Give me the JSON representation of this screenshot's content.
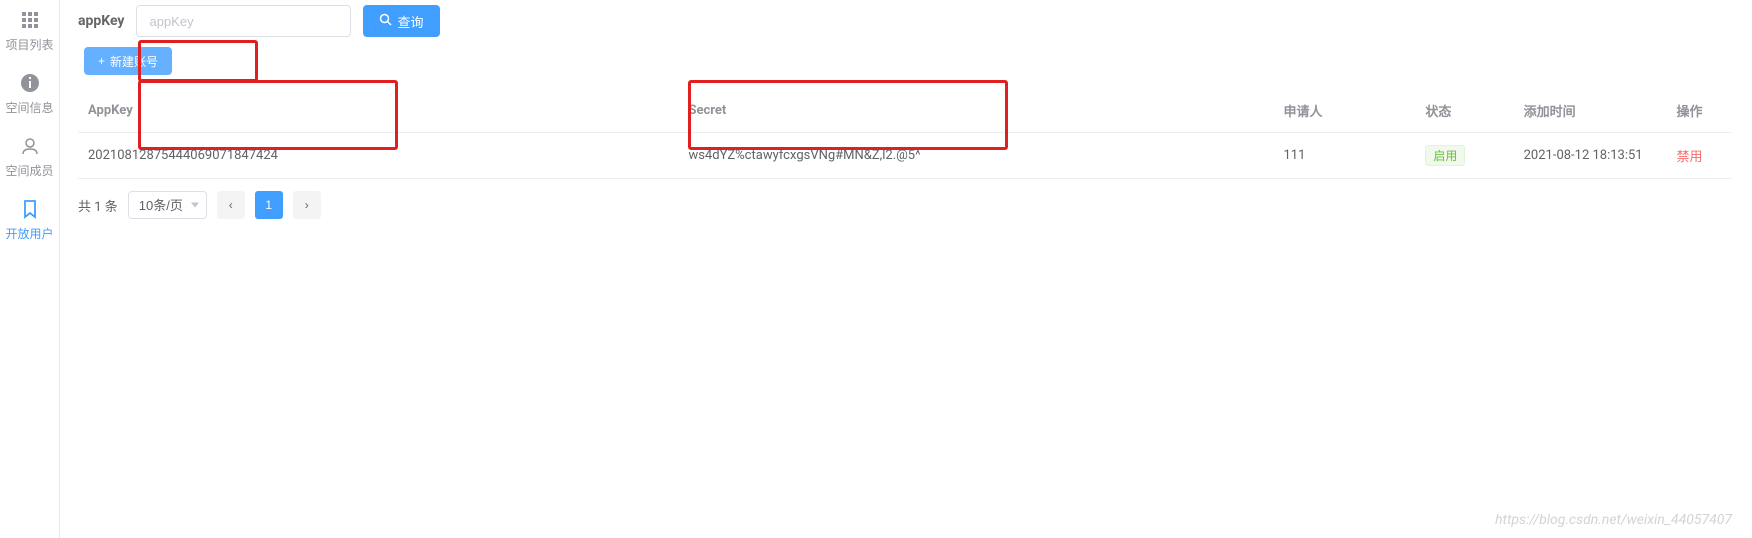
{
  "sidebar": {
    "items": [
      {
        "label": "项目列表",
        "icon": "grid-icon",
        "active": false
      },
      {
        "label": "空间信息",
        "icon": "info-icon",
        "active": false
      },
      {
        "label": "空间成员",
        "icon": "user-icon",
        "active": false
      },
      {
        "label": "开放用户",
        "icon": "bookmark-icon",
        "active": true
      }
    ]
  },
  "search": {
    "label": "appKey",
    "placeholder": "appKey",
    "button": "查询"
  },
  "toolbar": {
    "new_account": "新建账号"
  },
  "table": {
    "headers": {
      "appkey": "AppKey",
      "secret": "Secret",
      "applicant": "申请人",
      "status": "状态",
      "add_time": "添加时间",
      "operation": "操作"
    },
    "rows": [
      {
        "appkey": "20210812875444069071847424",
        "secret": "ws4dYZ%ctawyfcxgsVNg#MN&Z,l2.@5^",
        "applicant": "111",
        "status": "启用",
        "add_time": "2021-08-12 18:13:51",
        "operation": "禁用"
      }
    ]
  },
  "pagination": {
    "total_text": "共 1 条",
    "per_page": "10条/页",
    "current": "1"
  },
  "watermark": "https://blog.csdn.net/weixin_44057407"
}
